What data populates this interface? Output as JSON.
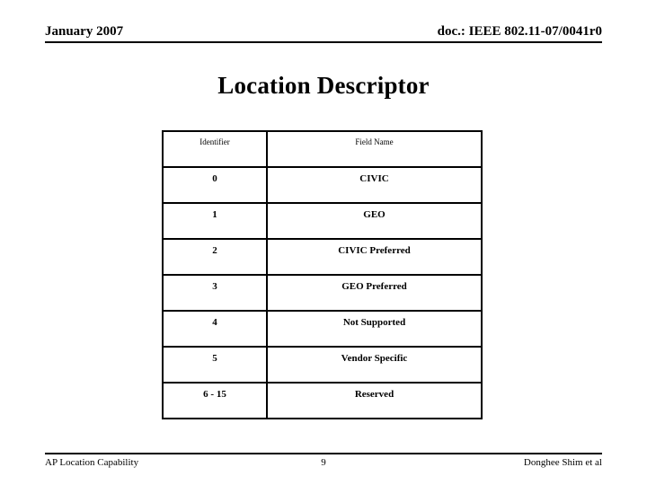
{
  "header": {
    "left": "January 2007",
    "right": "doc.: IEEE 802.11-07/0041r0"
  },
  "title": "Location Descriptor",
  "table": {
    "columns": [
      "Identifier",
      "Field Name"
    ],
    "rows": [
      {
        "identifier": "0",
        "field_name": "CIVIC"
      },
      {
        "identifier": "1",
        "field_name": "GEO"
      },
      {
        "identifier": "2",
        "field_name": "CIVIC Preferred"
      },
      {
        "identifier": "3",
        "field_name": "GEO Preferred"
      },
      {
        "identifier": "4",
        "field_name": "Not Supported"
      },
      {
        "identifier": "5",
        "field_name": "Vendor Specific"
      },
      {
        "identifier": "6 - 15",
        "field_name": "Reserved"
      }
    ]
  },
  "footer": {
    "left": "AP Location Capability",
    "page": "9",
    "right": "Donghee Shim et al"
  }
}
